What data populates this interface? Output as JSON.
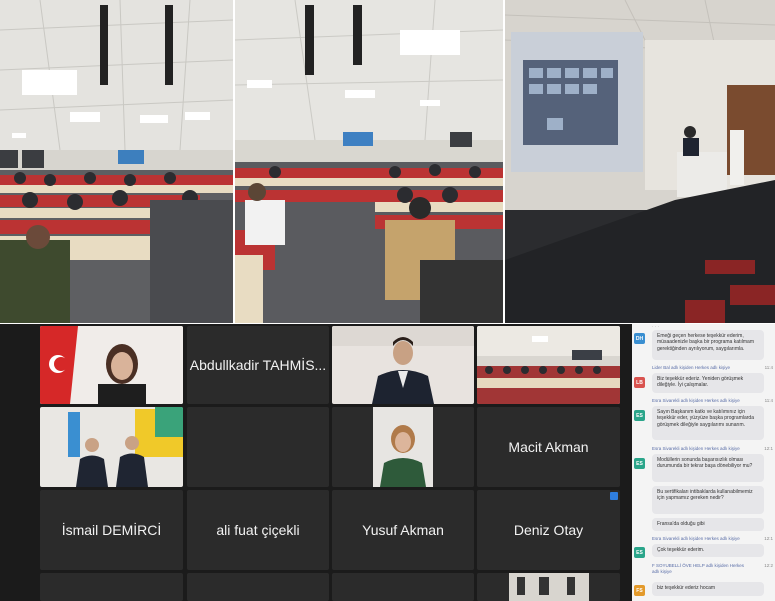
{
  "meeting": {
    "tiles": [
      {
        "id": "t1",
        "name": ""
      },
      {
        "id": "t2",
        "name": "Abdullkadir TAHMİS..."
      },
      {
        "id": "t3",
        "name": ""
      },
      {
        "id": "t4",
        "name": ""
      },
      {
        "id": "t5",
        "name": ""
      },
      {
        "id": "t6",
        "name": ""
      },
      {
        "id": "t7",
        "name": ""
      },
      {
        "id": "t8",
        "name": "Macit Akman"
      },
      {
        "id": "t9",
        "name": "İsmail DEMİRCİ"
      },
      {
        "id": "t10",
        "name": "ali fuat çiçekli"
      },
      {
        "id": "t11",
        "name": "Yusuf Akman"
      },
      {
        "id": "t12",
        "name": "Deniz Otay"
      }
    ]
  },
  "chat": {
    "messages": [
      {
        "avatar": "DH",
        "color": "#3a8fd1",
        "sender": "",
        "time": "",
        "text": "Emeği geçen herkese teşekkür ederim, müsaadenizle başka bir programa katılmam gerektiğinden ayrılıyorum, saygılarımla."
      },
      {
        "avatar": "LB",
        "color": "#d9534f",
        "sender": "Lider Bal adlı kişiden Herkes adlı kişiye",
        "time": "11:4",
        "text": "Biz teşekkür ederiz. Yeniden görüşmek dileğiyle. İyi çalışmalar."
      },
      {
        "avatar": "ES",
        "color": "#2aa58a",
        "sender": "Esra Sivarekli adlı kişiden Herkes adlı kişiye",
        "time": "11:4",
        "text": "Sayın Başkanım katkı ve katılımınız için teşekkür eder, yüzyüze başka programlarda görüşmek dileğiyle saygılarımı sunarım."
      },
      {
        "avatar": "ES",
        "color": "#2aa58a",
        "sender": "Esra Sivarekli adlı kişiden Herkes adlı kişiye",
        "time": "12:1",
        "text": "Modüllerin sonunda başarısızlık olması durumunda bir tekrar başa dönebiliyor mu?"
      },
      {
        "avatar": "",
        "color": "",
        "sender": "",
        "time": "",
        "text": "Bu sertifikaları intibaklarda kullanabilmemiz için yapmamız gereken nedir?"
      },
      {
        "avatar": "",
        "color": "",
        "sender": "",
        "time": "",
        "text": "Fransa'da olduğu gibi"
      },
      {
        "avatar": "ES",
        "color": "#2aa58a",
        "sender": "Esra Sivarekli adlı kişiden Herkes adlı kişiye",
        "time": "12:1",
        "text": "Çok teşekkür ederim."
      },
      {
        "avatar": "",
        "color": "",
        "sender": "F SOYUBELLİ ÖVE HELP adlı kişiden Herkes adlı kişiye",
        "time": "12:2",
        "text": ""
      },
      {
        "avatar": "FS",
        "color": "#e39a2b",
        "sender": "",
        "time": "",
        "text": "biz teşekkür ederiz hocam"
      }
    ]
  }
}
